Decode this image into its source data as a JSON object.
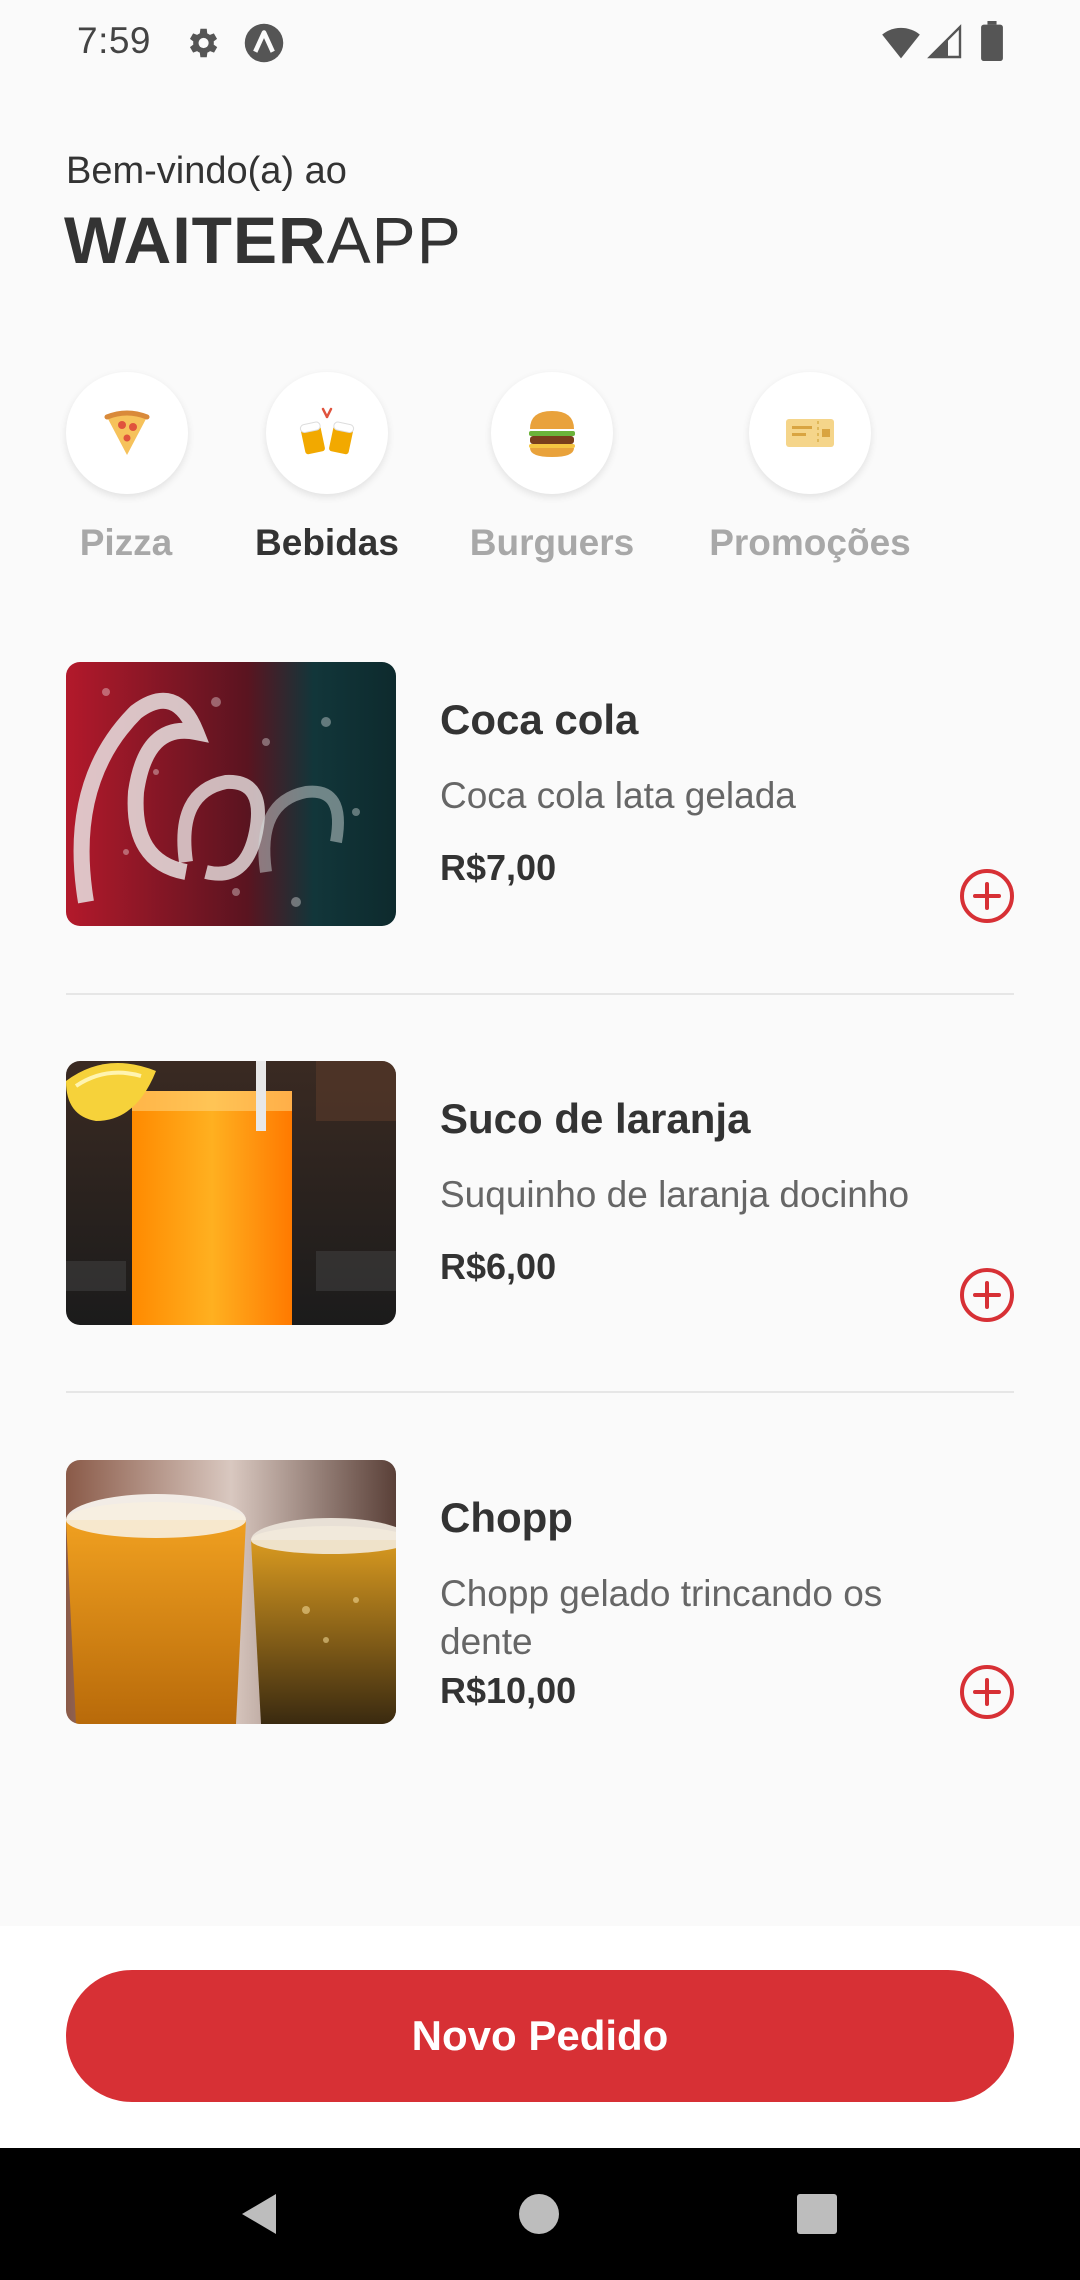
{
  "status_bar": {
    "time": "7:59",
    "icons": [
      "gear-icon",
      "a-icon",
      "wifi-icon",
      "signal-icon",
      "battery-icon"
    ]
  },
  "header": {
    "welcome": "Bem-vindo(a) ao",
    "brand_bold": "WAITER",
    "brand_light": "APP"
  },
  "categories": [
    {
      "label": "Pizza",
      "icon": "pizza-icon",
      "active": false
    },
    {
      "label": "Bebidas",
      "icon": "beer-mugs-icon",
      "active": true
    },
    {
      "label": "Burguers",
      "icon": "burger-icon",
      "active": false
    },
    {
      "label": "Promoções",
      "icon": "ticket-icon",
      "active": false
    }
  ],
  "products": [
    {
      "name": "Coca cola",
      "description": "Coca cola lata gelada",
      "price": "R$7,00",
      "image": "coca-cola-can"
    },
    {
      "name": "Suco de laranja",
      "description": "Suquinho de laranja docinho",
      "price": "R$6,00",
      "image": "orange-juice-glass"
    },
    {
      "name": "Chopp",
      "description": "Chopp gelado trincando os dente",
      "price": "R$10,00",
      "image": "beer-glasses"
    }
  ],
  "footer": {
    "order_button_label": "Novo Pedido"
  },
  "colors": {
    "accent": "#d73035",
    "background": "#fafafa",
    "text": "#333333",
    "muted": "#a8a8a8"
  }
}
